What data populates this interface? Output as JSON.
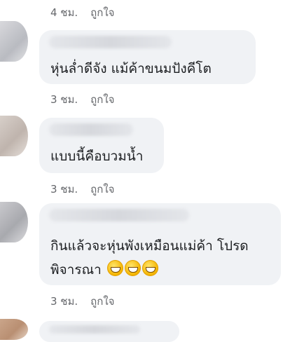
{
  "comments": [
    {
      "time": "4 ชม.",
      "like_label": "ถูกใจ"
    },
    {
      "text": "หุ่นล่ำดีจัง แม้ค้าขนมปังคีโต",
      "time": "3 ชม.",
      "like_label": "ถูกใจ"
    },
    {
      "text": "แบบนี้คือบวมน้ำ",
      "time": "3 ชม.",
      "like_label": "ถูกใจ"
    },
    {
      "text_line1": "กินแล้วจะหุ่นพังเหมือนแม่ค้า โปรด",
      "text_line2": "พิจารณา",
      "emoji": [
        "grinning-face",
        "grinning-face",
        "grinning-face"
      ],
      "time": "3 ชม.",
      "like_label": "ถูกใจ"
    }
  ]
}
